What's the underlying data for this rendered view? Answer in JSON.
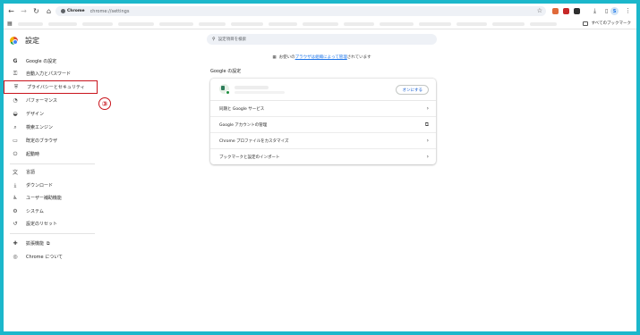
{
  "toolbar": {
    "back_icon": "←",
    "forward_icon": "→",
    "reload_icon": "↻",
    "home_icon": "⌂",
    "omnibox_badge": "Chrome",
    "url": "chrome://settings",
    "star_icon": "☆",
    "download_icon": "⤓",
    "menu_icon": "⋮",
    "avatar_letter": "S"
  },
  "bookmarks": {
    "apps_icon": "▦",
    "all_bookmarks": "すべてのブックマーク"
  },
  "sidebar": {
    "title": "設定",
    "items": [
      {
        "label": "Google の設定",
        "icon": "G"
      },
      {
        "label": "自動入力とパスワード",
        "icon": "⚿"
      },
      {
        "label": "プライバシーとセキュリティ",
        "icon": "⛨"
      },
      {
        "label": "パフォーマンス",
        "icon": "◔"
      },
      {
        "label": "デザイン",
        "icon": "◒"
      },
      {
        "label": "検索エンジン",
        "icon": "⌕"
      },
      {
        "label": "既定のブラウザ",
        "icon": "▭"
      },
      {
        "label": "起動時",
        "icon": "⏻"
      },
      {
        "label": "言語",
        "icon": "文"
      },
      {
        "label": "ダウンロード",
        "icon": "⤓"
      },
      {
        "label": "ユーザー補助機能",
        "icon": "♿"
      },
      {
        "label": "システム",
        "icon": "⚙"
      },
      {
        "label": "設定のリセット",
        "icon": "↺"
      },
      {
        "label": "拡張機能",
        "icon": "✚"
      },
      {
        "label": "Chrome について",
        "icon": "◎"
      }
    ],
    "external_icon": "⧉"
  },
  "annotation": {
    "step_marker": "③",
    "marker_color": "#c9141c"
  },
  "main": {
    "search_icon": "⚲",
    "search_placeholder": "設定項目を検索",
    "managed_icon": "▦",
    "managed_prefix": "お使いの",
    "managed_link": "ブラウザは組織によって管理",
    "managed_suffix": "されています",
    "section_title": "Google の設定",
    "sync_button": "オンにする",
    "rows": [
      {
        "label": "同期と Google サービス",
        "icon": "›"
      },
      {
        "label": "Google アカウントの管理",
        "icon": "⧉"
      },
      {
        "label": "Chrome プロファイルをカスタマイズ",
        "icon": "›"
      },
      {
        "label": "ブックマークと設定のインポート",
        "icon": "›"
      }
    ]
  },
  "colors": {
    "frame_border": "#1bb7cb",
    "accent_blue": "#1a73e8"
  }
}
